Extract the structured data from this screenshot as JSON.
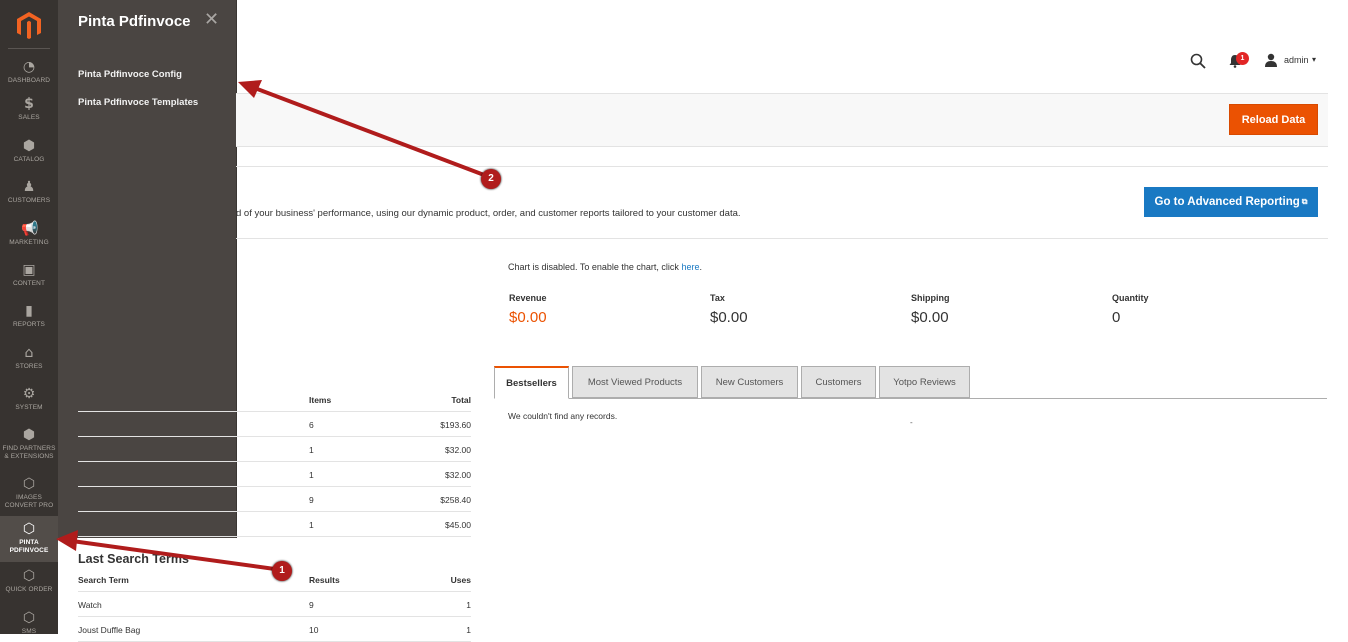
{
  "nav": {
    "items": [
      {
        "label": "DASHBOARD",
        "icon": "dashboard-icon"
      },
      {
        "label": "SALES",
        "icon": "dollar-icon"
      },
      {
        "label": "CATALOG",
        "icon": "cube-icon"
      },
      {
        "label": "CUSTOMERS",
        "icon": "person-icon"
      },
      {
        "label": "MARKETING",
        "icon": "megaphone-icon"
      },
      {
        "label": "CONTENT",
        "icon": "layout-icon"
      },
      {
        "label": "REPORTS",
        "icon": "bar-chart-icon"
      },
      {
        "label": "STORES",
        "icon": "store-icon"
      },
      {
        "label": "SYSTEM",
        "icon": "gear-icon"
      },
      {
        "label": "FIND PARTNERS & EXTENSIONS",
        "icon": "box-icon"
      },
      {
        "label": "IMAGES CONVERT PRO",
        "icon": "hexagon-icon"
      },
      {
        "label": "PINTA PDFINVOCE",
        "icon": "hexagon-icon"
      },
      {
        "label": "QUICK ORDER",
        "icon": "hexagon-icon"
      },
      {
        "label": "SMS",
        "icon": "hexagon-icon"
      }
    ]
  },
  "flyout": {
    "title": "Pinta Pdfinvoce",
    "close": "✕",
    "links": [
      "Pinta Pdfinvoce Config",
      "Pinta Pdfinvoce Templates"
    ]
  },
  "header": {
    "notifications_count": "1",
    "user": "admin"
  },
  "actions": {
    "reload_label": "Reload Data"
  },
  "advanced_reporting": {
    "text": "d of your business' performance, using our dynamic product, order, and customer reports tailored to your customer data.",
    "button_label": "Go to Advanced Reporting",
    "button_icon": "⧉"
  },
  "chart": {
    "note": "Chart is disabled. To enable the chart, click ",
    "link": "here",
    "note_end": "."
  },
  "totals": [
    {
      "label": "Revenue",
      "value": "$0.00",
      "color": "#eb5202"
    },
    {
      "label": "Tax",
      "value": "$0.00"
    },
    {
      "label": "Shipping",
      "value": "$0.00"
    },
    {
      "label": "Quantity",
      "value": "0"
    }
  ],
  "tabs": [
    "Bestsellers",
    "Most Viewed Products",
    "New Customers",
    "Customers",
    "Yotpo Reviews"
  ],
  "tab_content": {
    "empty": "We couldn't find any records.",
    "dash": "-"
  },
  "orders_table": {
    "headers": [
      "",
      "Items",
      "Total"
    ],
    "rows": [
      [
        "",
        "6",
        "$193.60"
      ],
      [
        "",
        "1",
        "$32.00"
      ],
      [
        "",
        "1",
        "$32.00"
      ],
      [
        "",
        "9",
        "$258.40"
      ],
      [
        "",
        "1",
        "$45.00"
      ]
    ]
  },
  "search_terms": {
    "title": "Last Search Terms",
    "headers": [
      "Search Term",
      "Results",
      "Uses"
    ],
    "rows": [
      [
        "Watch",
        "9",
        "1"
      ],
      [
        "Joust Duffle Bag",
        "10",
        "1"
      ]
    ]
  },
  "annotations": [
    "1",
    "2"
  ],
  "colors": {
    "nav_bg": "#373330",
    "flyout_bg": "#4a4542",
    "accent_orange": "#eb5202",
    "accent_blue": "#1979c3",
    "annotation_red": "#b01c1c"
  }
}
